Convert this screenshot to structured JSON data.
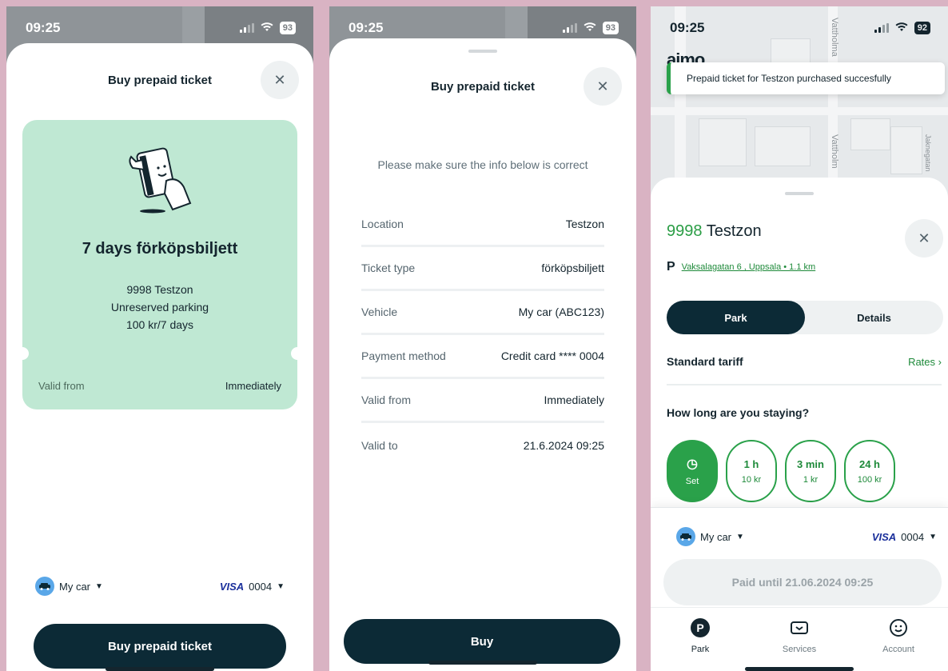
{
  "screens": [
    {
      "status": {
        "time": "09:25",
        "battery": "93"
      },
      "title": "Buy prepaid ticket",
      "ticket": {
        "name": "7 days förköpsbiljett",
        "zone": "9998 Testzon",
        "type": "Unreserved parking",
        "price": "100 kr/7 days",
        "valid_from_label": "Valid from",
        "valid_from_value": "Immediately"
      },
      "vehicle": "My car",
      "card_brand": "VISA",
      "card_last4": "0004",
      "action": "Buy prepaid ticket"
    },
    {
      "status": {
        "time": "09:25",
        "battery": "93"
      },
      "title": "Buy prepaid ticket",
      "note": "Please make sure the info below is correct",
      "rows": [
        {
          "label": "Location",
          "value": "Testzon"
        },
        {
          "label": "Ticket type",
          "value": "förköpsbiljett"
        },
        {
          "label": "Vehicle",
          "value": "My car (ABC123)"
        },
        {
          "label": "Payment method",
          "value": "Credit card **** 0004"
        },
        {
          "label": "Valid from",
          "value": "Immediately"
        },
        {
          "label": "Valid to",
          "value": "21.6.2024 09:25"
        }
      ],
      "action": "Buy"
    },
    {
      "status": {
        "time": "09:25",
        "battery": "92"
      },
      "logo": "aimo",
      "map_labels": [
        "Vattholma",
        "Vattholm",
        "Jaknegatan"
      ],
      "toast": "Prepaid ticket for Testzon purchased succesfully",
      "zone_number": "9998",
      "zone_name": "Testzon",
      "parking_symbol": "P",
      "address": "Vaksalagatan 6 , Uppsala • 1.1 km",
      "tabs": [
        "Park",
        "Details"
      ],
      "tariff": "Standard tariff",
      "rates": "Rates",
      "stay_question": "How long are you staying?",
      "durations": [
        {
          "time": "",
          "price": "Set"
        },
        {
          "time": "1 h",
          "price": "10 kr"
        },
        {
          "time": "3 min",
          "price": "1 kr"
        },
        {
          "time": "24 h",
          "price": "100 kr"
        }
      ],
      "vehicle": "My car",
      "card_brand": "VISA",
      "card_last4": "0004",
      "paid_until": "Paid until 21.06.2024 09:25",
      "nav": [
        {
          "label": "Park",
          "icon": "parking-icon"
        },
        {
          "label": "Services",
          "icon": "services-icon"
        },
        {
          "label": "Account",
          "icon": "account-icon"
        }
      ]
    }
  ],
  "colors": {
    "accent_green": "#2aa14a",
    "dark_navy": "#0c2a36",
    "ticket_mint": "#bfe8d3"
  }
}
